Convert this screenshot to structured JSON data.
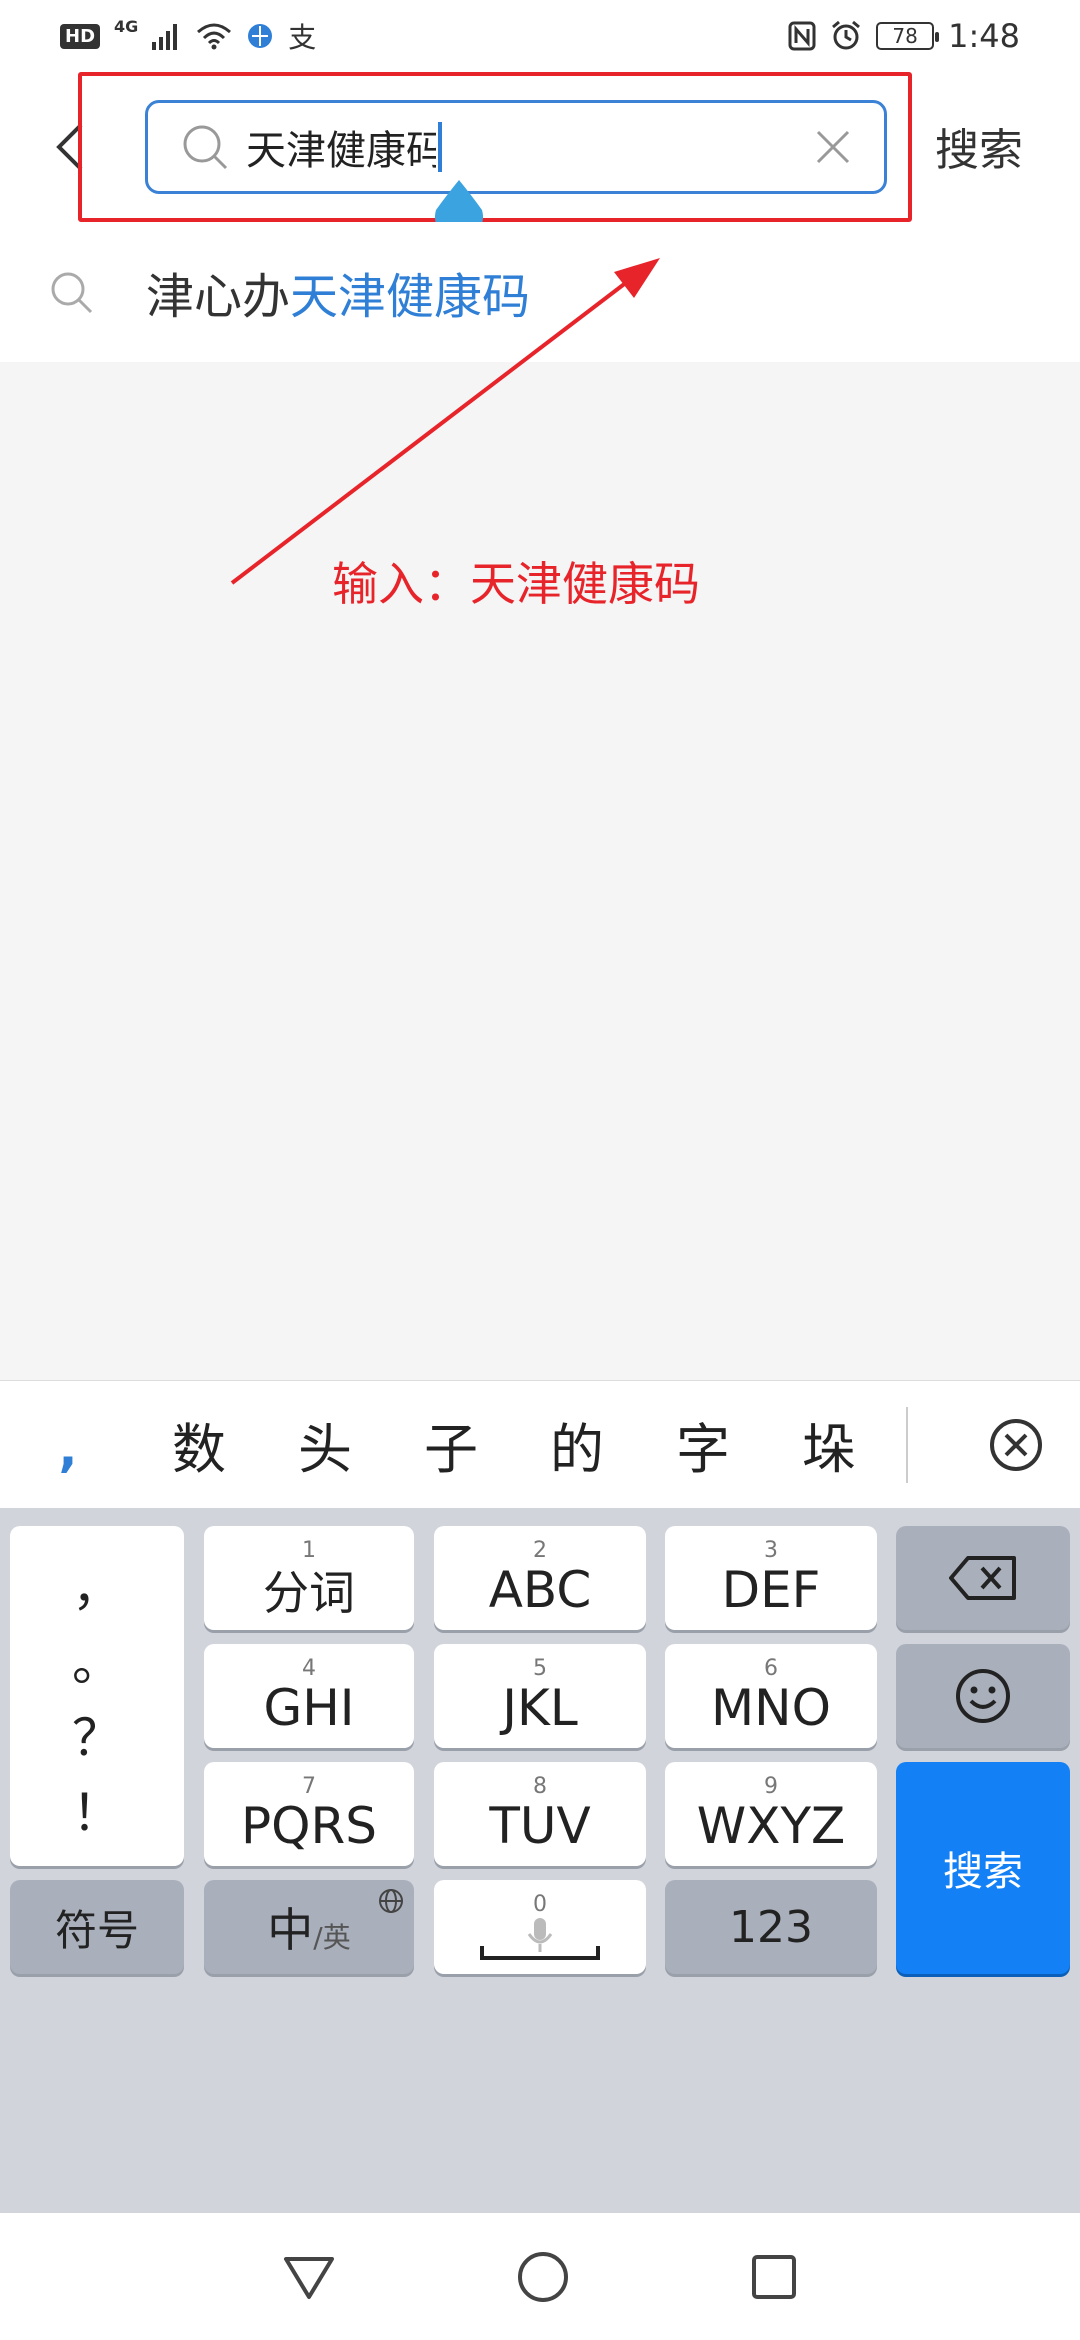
{
  "status_bar": {
    "hd_badge": "HD",
    "network": "4G",
    "alipay_glyph": "支",
    "battery": "78",
    "time": "1:48"
  },
  "search": {
    "value": "天津健康码",
    "action_label": "搜索"
  },
  "suggestion": {
    "prefix": "津心办",
    "highlight": "天津健康码"
  },
  "annotation": {
    "text": "输入：天津健康码",
    "color": "#e8242b"
  },
  "candidates": {
    "first": ",",
    "items": [
      "数",
      "头",
      "子",
      "的",
      "字",
      "垛"
    ]
  },
  "keyboard": {
    "punct": [
      "，",
      "。",
      "？",
      "！"
    ],
    "keys": [
      {
        "num": "1",
        "label": "分词"
      },
      {
        "num": "2",
        "label": "ABC"
      },
      {
        "num": "3",
        "label": "DEF"
      },
      {
        "num": "4",
        "label": "GHI"
      },
      {
        "num": "5",
        "label": "JKL"
      },
      {
        "num": "6",
        "label": "MNO"
      },
      {
        "num": "7",
        "label": "PQRS"
      },
      {
        "num": "8",
        "label": "TUV"
      },
      {
        "num": "9",
        "label": "WXYZ"
      }
    ],
    "symbols_label": "符号",
    "lang_main": "中",
    "lang_sub": "/英",
    "space_num": "0",
    "num123_label": "123",
    "search_label": "搜索"
  },
  "colors": {
    "accent_blue": "#2f7fd6",
    "search_key_blue": "#1380f5",
    "annotation_red": "#e8242b"
  },
  "icons": [
    "back-chevron-icon",
    "search-icon",
    "clear-x-icon",
    "globe-icon",
    "mic-icon",
    "backspace-icon",
    "emoji-icon",
    "close-circle-icon",
    "nav-back-icon",
    "nav-home-icon",
    "nav-recents-icon"
  ]
}
